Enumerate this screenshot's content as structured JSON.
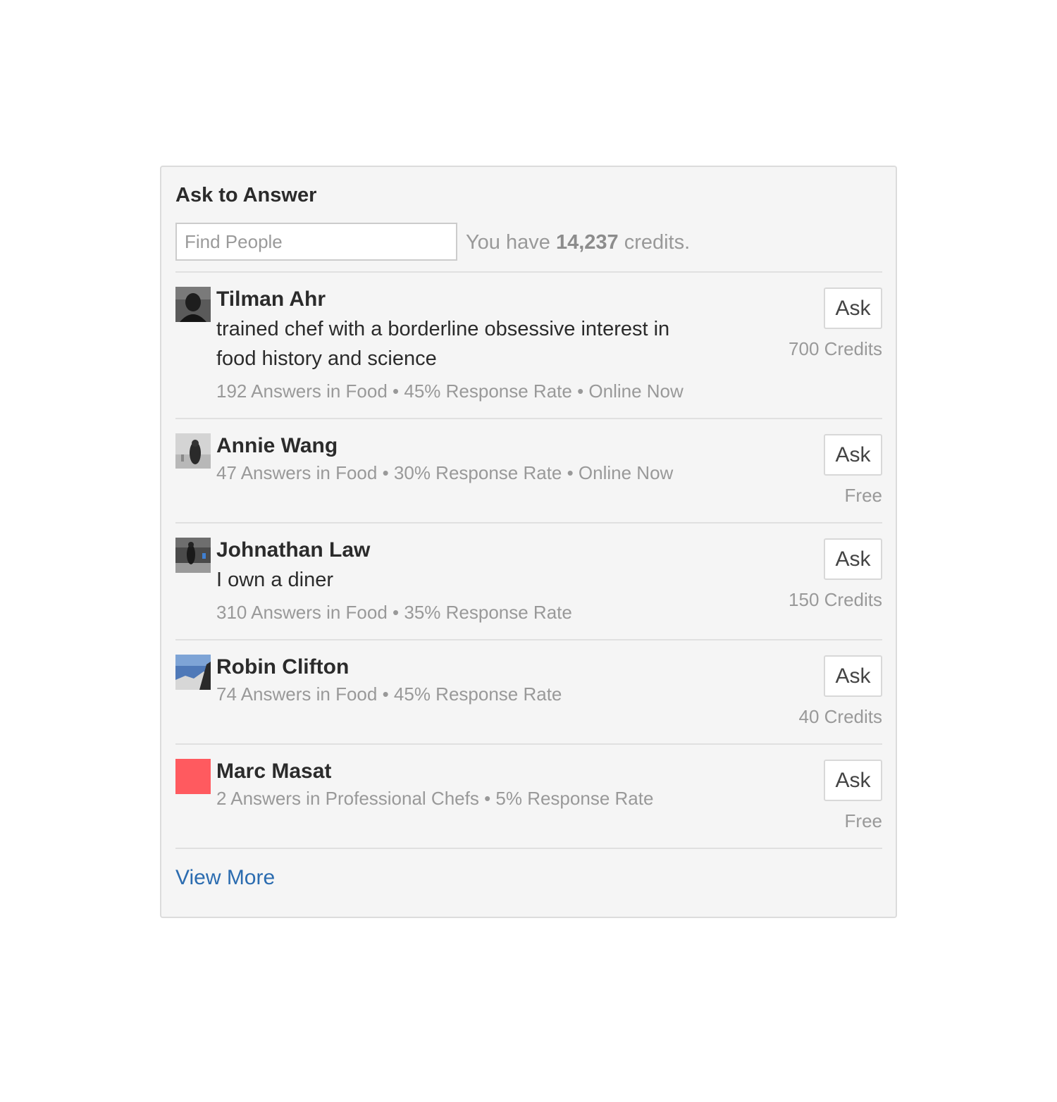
{
  "panel": {
    "title": "Ask to Answer",
    "search_placeholder": "Find People",
    "credits_prefix": "You have ",
    "credits_amount": "14,237",
    "credits_suffix": " credits.",
    "view_more": "View More"
  },
  "people": [
    {
      "name": "Tilman Ahr",
      "bio": "trained chef with a borderline obsessive interest in food history and science",
      "meta": "192 Answers in Food • 45% Response Rate • Online Now",
      "ask_label": "Ask",
      "price": "700 Credits"
    },
    {
      "name": "Annie Wang",
      "bio": "",
      "meta": "47 Answers in Food • 30% Response Rate • Online Now",
      "ask_label": "Ask",
      "price": "Free"
    },
    {
      "name": "Johnathan Law",
      "bio": "I own a diner",
      "meta": "310 Answers in Food • 35% Response Rate",
      "ask_label": "Ask",
      "price": "150 Credits"
    },
    {
      "name": "Robin Clifton",
      "bio": "",
      "meta": "74 Answers in Food • 45% Response Rate",
      "ask_label": "Ask",
      "price": "40 Credits"
    },
    {
      "name": "Marc Masat",
      "bio": "",
      "meta": "2 Answers in Professional Chefs • 5% Response Rate",
      "ask_label": "Ask",
      "price": "Free"
    }
  ],
  "colors": {
    "panel_bg": "#f5f5f5",
    "link": "#2b6cb0",
    "muted_text": "#999999",
    "placeholder_avatar": "#ff5a5f"
  }
}
